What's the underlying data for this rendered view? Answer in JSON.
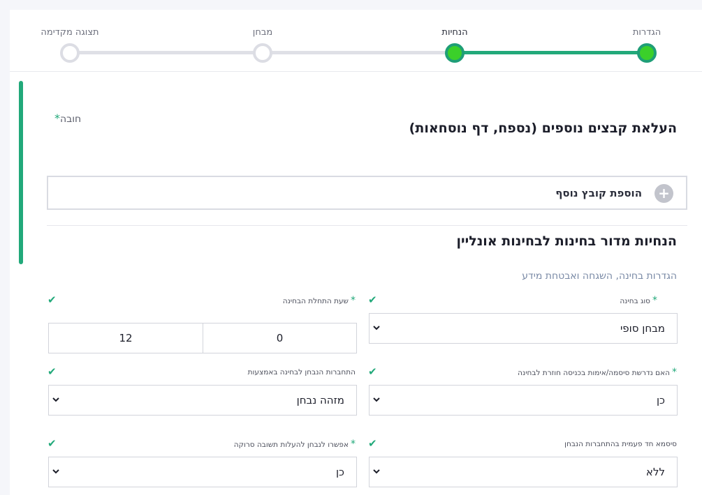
{
  "stepper": {
    "steps": [
      {
        "label": "הגדרות",
        "status": "done"
      },
      {
        "label": "הנחיות",
        "status": "current"
      },
      {
        "label": "מבחן",
        "status": "todo"
      },
      {
        "label": "תצוגה מקדימה",
        "status": "todo"
      }
    ]
  },
  "required_note": "חובה",
  "required_star": "*",
  "upload_section": {
    "title": "העלאת קבצים נוספים (נספח, דף נוסחאות)",
    "add_button_label": "הוספת קובץ נוסף",
    "add_icon": "+"
  },
  "guidelines_section": {
    "title": "הנחיות מדור בחינות לבחינות אונליין",
    "subtitle": "הגדרות בחינה, השגחה ואבטחת מידע"
  },
  "fields": {
    "exam_type": {
      "label": "סוג בחינה",
      "value": "מבחן סופי"
    },
    "exam_start_time": {
      "label": "שעת התחלת הבחינה",
      "minutes": "0",
      "hours": "12"
    },
    "password_reentry": {
      "label": "האם נדרשת סיסמה/אימות בכניסה חוזרת לבחינה",
      "value": "כן"
    },
    "examinee_login_method": {
      "label": "התחברות הנבחן לבחינה באמצעות",
      "value": "מזהה נבחן"
    },
    "one_time_password": {
      "label": "סיסמא חד פעמית בהתחברות הנבחן",
      "value": "ללא"
    },
    "allow_scanned_answer": {
      "label": "אפשרו לנבחן להעלות תשובה סרוקה",
      "value": "כן"
    }
  },
  "check_glyph": "✔",
  "colors": {
    "accent": "#22a97a",
    "step_done_fill": "#3bd02a",
    "step_todo_border": "#dcdde4"
  }
}
